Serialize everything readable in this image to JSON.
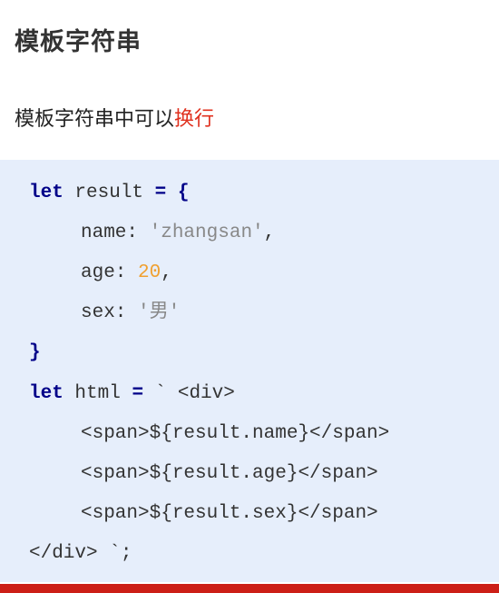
{
  "heading": "模板字符串",
  "description": {
    "prefix": "模板字符串中可以",
    "highlight": "换行"
  },
  "code": {
    "l1": {
      "kw": "let",
      "ident": " result ",
      "op": "= {"
    },
    "l2": {
      "key": "name: ",
      "str": "'zhangsan'",
      "tail": ","
    },
    "l3": {
      "key": "age: ",
      "num": "20",
      "tail": ","
    },
    "l4": {
      "key": "sex: ",
      "str": "'男'"
    },
    "l5": {
      "op": "}"
    },
    "l6": {
      "kw": "let",
      "ident": " html ",
      "op": "=",
      "tail": " ` <div>"
    },
    "l7": "<span>${result.name}</span>",
    "l8": "<span>${result.age}</span>",
    "l9": "<span>${result.sex}</span>",
    "l10": "</div> `;"
  },
  "colors": {
    "keyword": "#000088",
    "string": "#888888",
    "number": "#f0a030",
    "highlight": "#e0301e",
    "code_bg": "#e6eefb",
    "bottom_bar": "#cc1f17"
  }
}
